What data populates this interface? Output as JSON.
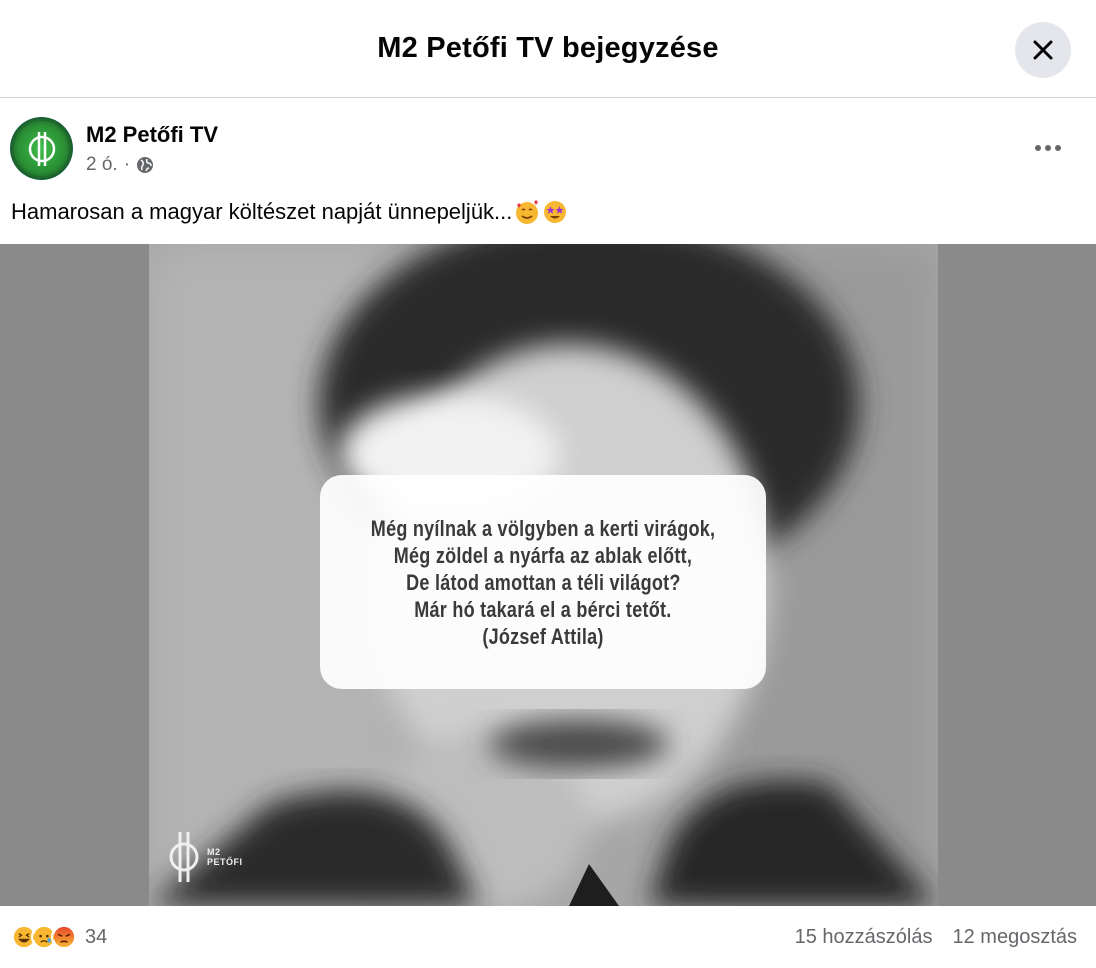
{
  "modal": {
    "title": "M2 Petőfi TV bejegyzése"
  },
  "post": {
    "page_name": "M2 Petőfi TV",
    "time": "2 ó.",
    "separator": "·",
    "audience_icon": "globe-icon",
    "text": "Hamarosan a magyar költészet napját ünnepeljük...",
    "text_emojis": [
      "smiling-face-with-hearts-emoji",
      "star-struck-emoji"
    ]
  },
  "media": {
    "quote_lines": [
      "Még nyílnak a völgyben a kerti virágok,",
      "Még zöldel a nyárfa az ablak előtt,",
      "De látod amottan a téli világot?",
      "Már hó takará el a bérci tetőt.",
      "(József Attila)"
    ],
    "watermark": {
      "line1": "M2",
      "line2": "PETŐFI"
    }
  },
  "footer": {
    "reactions": [
      "haha-reaction",
      "sad-reaction",
      "angry-reaction"
    ],
    "reaction_count": "34",
    "comments": "15 hozzászólás",
    "shares": "12 megosztás"
  }
}
